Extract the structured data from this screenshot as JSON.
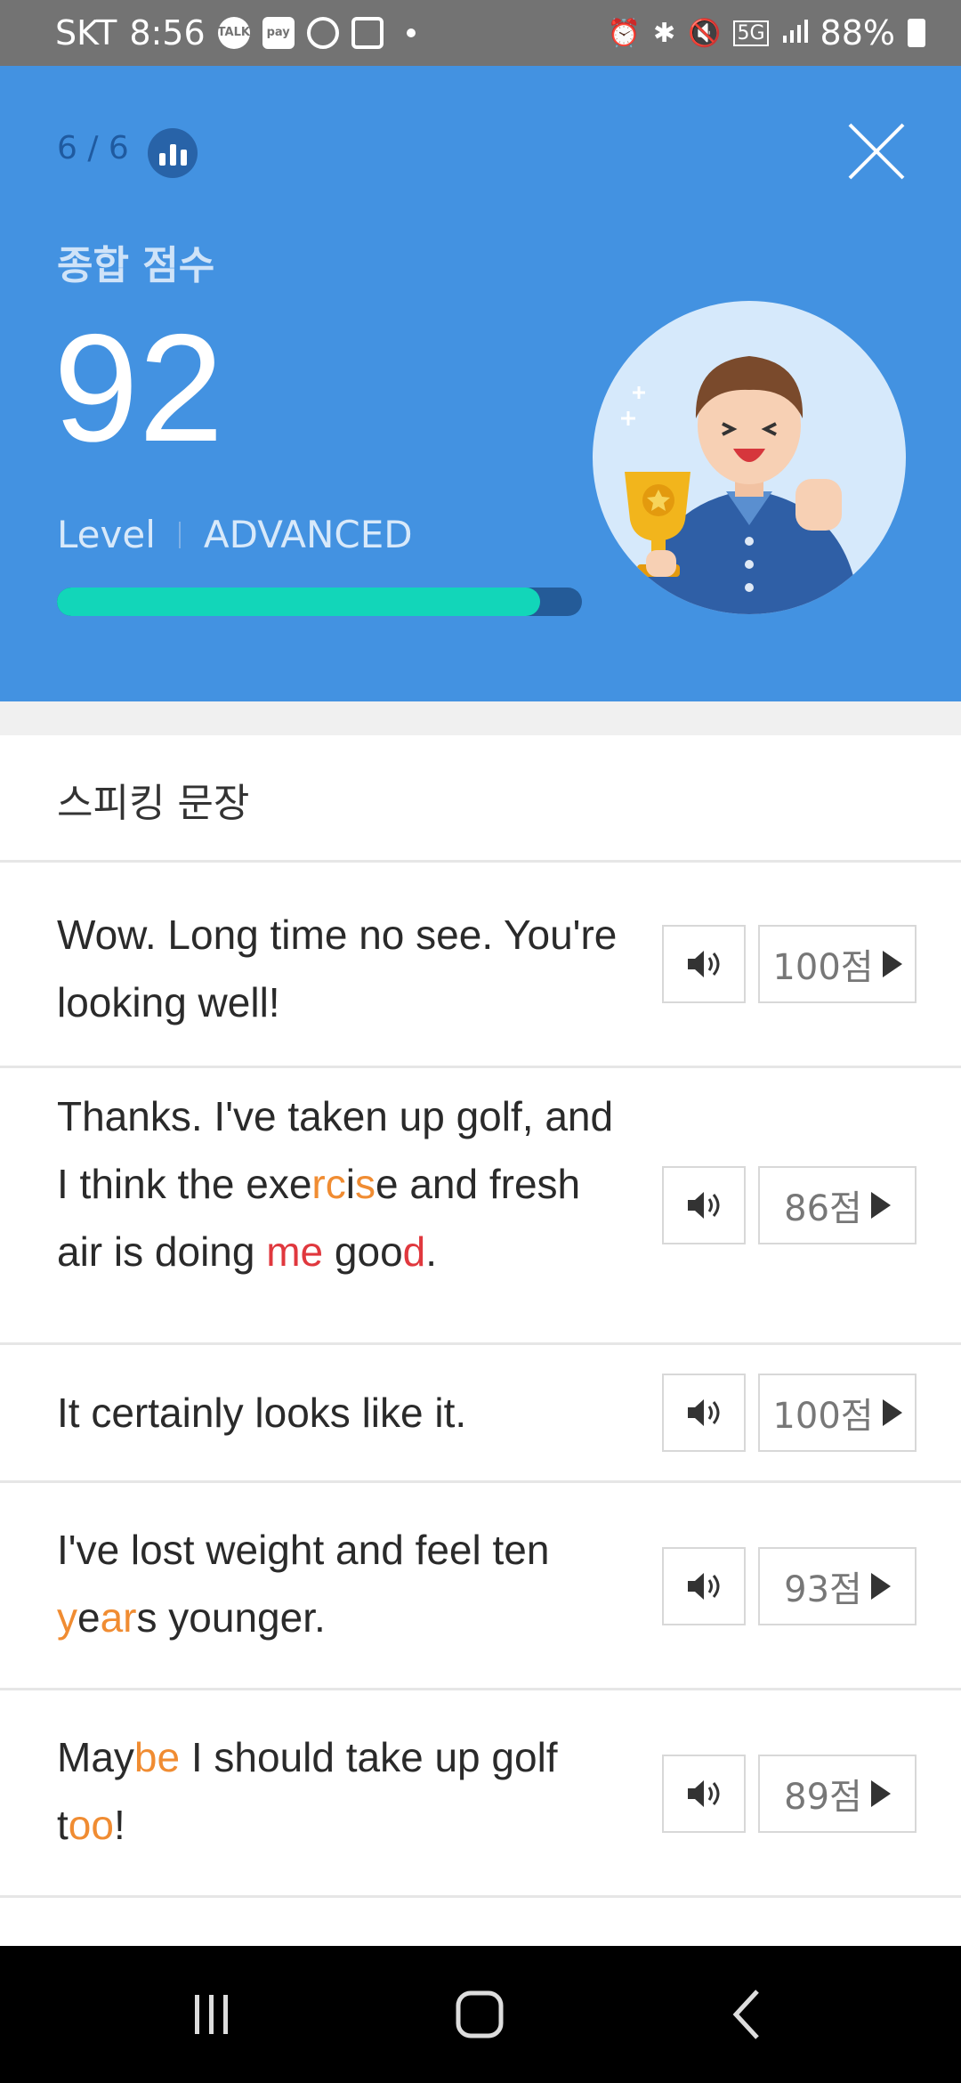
{
  "status_bar": {
    "carrier": "SKT",
    "time": "8:56",
    "icons_left": [
      "talk-icon",
      "pay-icon",
      "threads-icon",
      "gallery-icon",
      "dot-icon"
    ],
    "talk_label": "TALK",
    "pay_label": "pay",
    "icons_right": [
      "alarm-icon",
      "bluetooth-icon",
      "mute-icon",
      "5g-icon",
      "signal-icon",
      "battery-icon"
    ],
    "network": "5G",
    "battery": "88%"
  },
  "header": {
    "progress": "6 / 6",
    "score_label": "종합 점수",
    "score": "92",
    "level_label": "Level",
    "level_value": "ADVANCED",
    "level_progress_fraction": 0.92,
    "bar_fill_color": "#12d6b9",
    "background_color": "#4392e1"
  },
  "section": {
    "title": "스피킹 문장"
  },
  "sentences": [
    {
      "segments": [
        {
          "t": "Wow. Long time no see. You're looking well!",
          "c": ""
        }
      ],
      "score": "100점"
    },
    {
      "segments": [
        {
          "t": "Thanks. I've taken up golf, and I think the exe",
          "c": ""
        },
        {
          "t": "rc",
          "c": "o"
        },
        {
          "t": "i",
          "c": ""
        },
        {
          "t": "s",
          "c": "o"
        },
        {
          "t": "e and fresh air is doing ",
          "c": ""
        },
        {
          "t": "me",
          "c": "r"
        },
        {
          "t": " goo",
          "c": ""
        },
        {
          "t": "d",
          "c": "r"
        },
        {
          "t": ".",
          "c": ""
        }
      ],
      "score": "86점"
    },
    {
      "segments": [
        {
          "t": "It certainly looks like it.",
          "c": ""
        }
      ],
      "score": "100점"
    },
    {
      "segments": [
        {
          "t": "I've lost weight and feel ten ",
          "c": ""
        },
        {
          "t": "y",
          "c": "o"
        },
        {
          "t": "e",
          "c": ""
        },
        {
          "t": "ar",
          "c": "o"
        },
        {
          "t": "s younger.",
          "c": ""
        }
      ],
      "score": "93점"
    },
    {
      "segments": [
        {
          "t": "May",
          "c": ""
        },
        {
          "t": "be",
          "c": "o"
        },
        {
          "t": " I should take up golf t",
          "c": ""
        },
        {
          "t": "oo",
          "c": "o"
        },
        {
          "t": "!",
          "c": ""
        }
      ],
      "score": "89점"
    }
  ],
  "highlight_colors": {
    "minor": "#f08c32",
    "major": "#e0383e"
  },
  "nav_bar": [
    "recents-icon",
    "home-icon",
    "back-icon"
  ]
}
